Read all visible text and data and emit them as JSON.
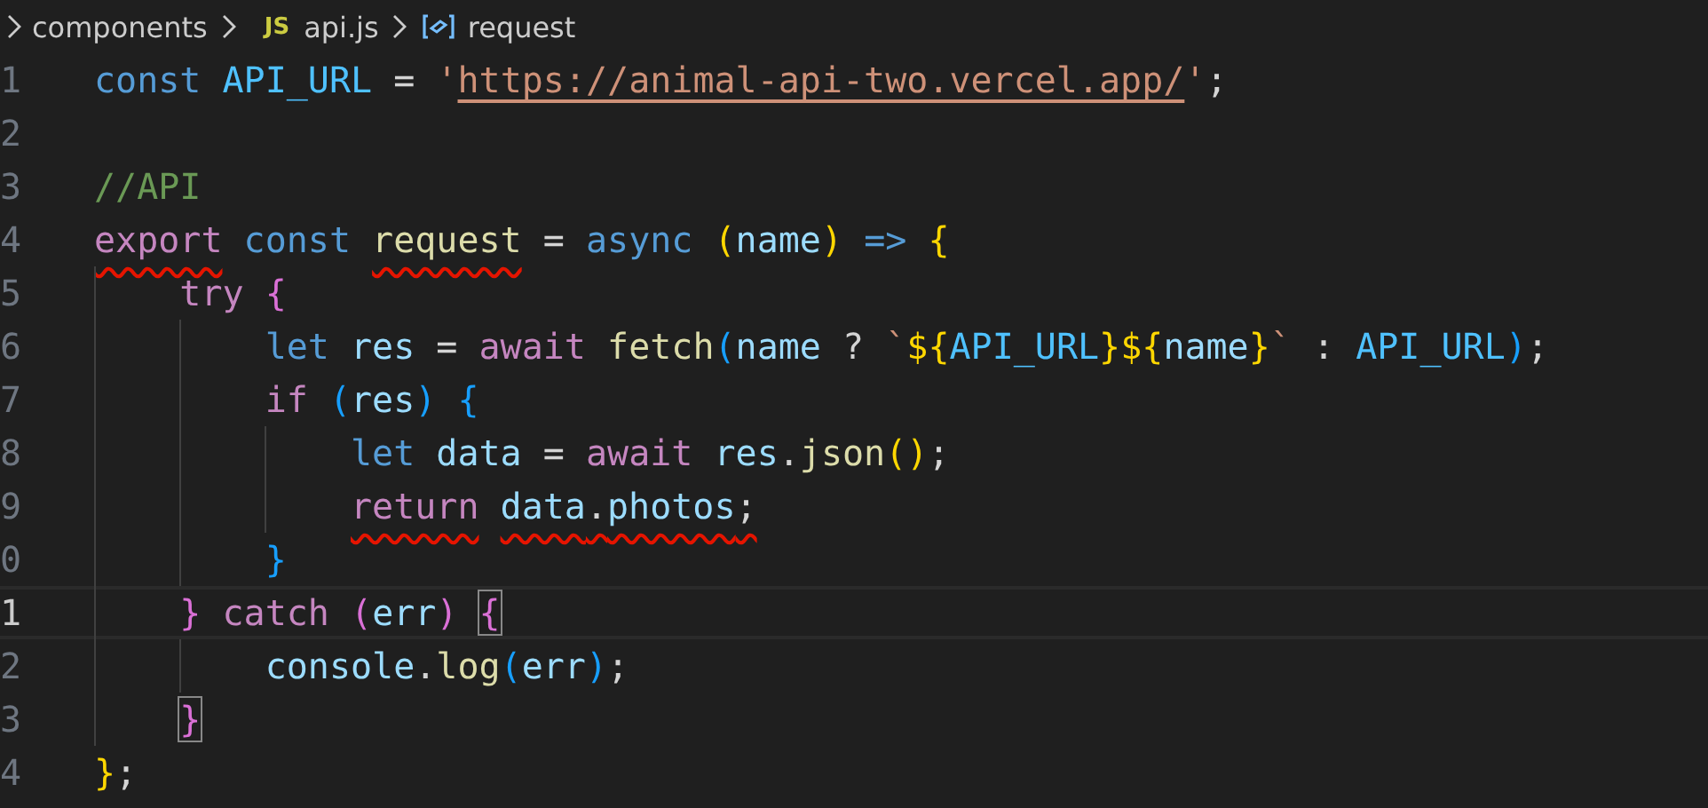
{
  "breadcrumb": [
    {
      "label": "components",
      "kind": "folder"
    },
    {
      "label": "api.js",
      "kind": "file",
      "badge": "JS"
    },
    {
      "label": "request",
      "kind": "symbol"
    }
  ],
  "lines": [
    {
      "number": "1",
      "current": false,
      "tokens": [
        {
          "text": "const",
          "kind": "keyword"
        },
        {
          "text": " API_URL",
          "kind": "constant"
        },
        {
          "text": " = "
        },
        {
          "text": "'",
          "kind": "string"
        },
        {
          "text": "https://animal-api-two.vercel.app/",
          "kind": "link"
        },
        {
          "text": "'",
          "kind": "string"
        },
        {
          "text": ";"
        }
      ]
    },
    {
      "number": "2",
      "current": false
    },
    {
      "number": "3",
      "current": false,
      "tokens": [
        {
          "text": "//API",
          "kind": "comment"
        }
      ]
    },
    {
      "number": "4",
      "current": false,
      "tokens": [
        {
          "text": "export",
          "kind": "control",
          "underlined": true
        },
        {
          "text": " const ",
          "kind": "keyword"
        },
        {
          "text": "request",
          "kind": "function",
          "underlined": true
        },
        {
          "text": " = "
        },
        {
          "text": "async",
          "kind": "keyword"
        },
        {
          "text": " (",
          "kind": "bracket1"
        },
        {
          "text": "name",
          "kind": "variable"
        },
        {
          "text": ")",
          "kind": "bracket1"
        },
        {
          "text": " =>",
          "kind": "keyword"
        },
        {
          "text": " {",
          "kind": "bracket1"
        }
      ]
    },
    {
      "number": "5",
      "current": false,
      "tokens": [
        {
          "text": "    try",
          "kind": "control"
        },
        {
          "text": " {",
          "kind": "bracket2"
        }
      ]
    },
    {
      "number": "6",
      "current": false,
      "tokens": [
        {
          "text": "        let",
          "kind": "keyword"
        },
        {
          "text": " res",
          "kind": "variable"
        },
        {
          "text": " = "
        },
        {
          "text": "await",
          "kind": "control"
        },
        {
          "text": " fetch",
          "kind": "function"
        },
        {
          "text": "(",
          "kind": "bracket3"
        },
        {
          "text": "name",
          "kind": "variable"
        },
        {
          "text": " ? "
        },
        {
          "text": "`",
          "kind": "string"
        },
        {
          "text": "${",
          "kind": "bracket1"
        },
        {
          "text": "API_URL",
          "kind": "constant"
        },
        {
          "text": "}",
          "kind": "bracket1"
        },
        {
          "text": "${",
          "kind": "bracket1"
        },
        {
          "text": "name",
          "kind": "variable"
        },
        {
          "text": "}",
          "kind": "bracket1"
        },
        {
          "text": "`",
          "kind": "string"
        },
        {
          "text": " : "
        },
        {
          "text": "API_URL",
          "kind": "constant"
        },
        {
          "text": ")",
          "kind": "bracket3"
        },
        {
          "text": ";"
        }
      ]
    },
    {
      "number": "7",
      "current": false,
      "tokens": [
        {
          "text": "        if",
          "kind": "control"
        },
        {
          "text": " (",
          "kind": "bracket3"
        },
        {
          "text": "res",
          "kind": "variable"
        },
        {
          "text": ")",
          "kind": "bracket3"
        },
        {
          "text": " {",
          "kind": "bracket3"
        }
      ]
    },
    {
      "number": "8",
      "current": false,
      "tokens": [
        {
          "text": "            let",
          "kind": "keyword"
        },
        {
          "text": " data",
          "kind": "variable"
        },
        {
          "text": " = "
        },
        {
          "text": "await",
          "kind": "control"
        },
        {
          "text": " res",
          "kind": "variable"
        },
        {
          "text": "."
        },
        {
          "text": "json",
          "kind": "function"
        },
        {
          "text": "()",
          "kind": "bracket1"
        },
        {
          "text": ";"
        }
      ]
    },
    {
      "number": "9",
      "current": false,
      "tokens": [
        {
          "text": "            return",
          "kind": "control",
          "underlined": true
        },
        {
          "text": " data",
          "kind": "variable",
          "underlined": true
        },
        {
          "text": ".",
          "underlined": true
        },
        {
          "text": "photos",
          "kind": "variable",
          "underlined": true
        },
        {
          "text": ";",
          "underlined": true
        }
      ]
    },
    {
      "number": "0",
      "current": false,
      "tokens": [
        {
          "text": "        }",
          "kind": "bracket3"
        }
      ]
    },
    {
      "number": "1",
      "current": true,
      "tokens": [
        {
          "text": "    }",
          "kind": "bracket2"
        },
        {
          "text": " catch",
          "kind": "control"
        },
        {
          "text": " (",
          "kind": "bracket2"
        },
        {
          "text": "err",
          "kind": "variable"
        },
        {
          "text": ") ",
          "kind": "bracket2"
        },
        {
          "text": "{",
          "kind": "bracket2",
          "matched": true
        }
      ]
    },
    {
      "number": "2",
      "current": false,
      "tokens": [
        {
          "text": "        console",
          "kind": "variable"
        },
        {
          "text": "."
        },
        {
          "text": "log",
          "kind": "function"
        },
        {
          "text": "(",
          "kind": "bracket3"
        },
        {
          "text": "err",
          "kind": "variable"
        },
        {
          "text": ")",
          "kind": "bracket3"
        },
        {
          "text": ";"
        }
      ]
    },
    {
      "number": "3",
      "current": false,
      "tokens": [
        {
          "text": "    }",
          "kind": "bracket2",
          "matched": true
        }
      ]
    },
    {
      "number": "4",
      "current": false,
      "tokens": [
        {
          "text": "}",
          "kind": "bracket1"
        },
        {
          "text": ";"
        }
      ]
    }
  ]
}
